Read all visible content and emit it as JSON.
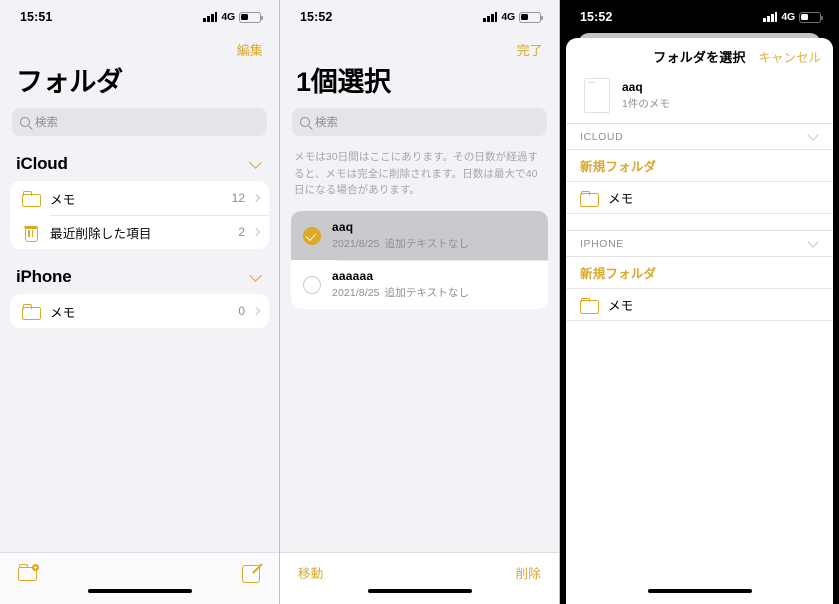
{
  "accent": "#dba828",
  "panels": [
    {
      "id": "folders",
      "status": {
        "time": "15:51",
        "network": "4G"
      },
      "nav_action": "編集",
      "title": "フォルダ",
      "search_placeholder": "検索",
      "sections": [
        {
          "header": "iCloud",
          "rows": [
            {
              "icon": "folder-icon",
              "label": "メモ",
              "count": "12"
            },
            {
              "icon": "trash-icon",
              "label": "最近削除した項目",
              "count": "2"
            }
          ]
        },
        {
          "header": "iPhone",
          "rows": [
            {
              "icon": "folder-icon",
              "label": "メモ",
              "count": "0"
            }
          ]
        }
      ],
      "toolbar": {
        "left_icon": "new-folder-icon",
        "right_icon": "compose-note-icon"
      }
    },
    {
      "id": "selection",
      "status": {
        "time": "15:52",
        "network": "4G"
      },
      "nav_action": "完了",
      "title": "1個選択",
      "search_placeholder": "検索",
      "description": "メモは30日間はここにあります。その日数が経過すると、メモは完全に削除されます。日数は最大で40日になる場合があります。",
      "notes": [
        {
          "title": "aaq",
          "date": "2021/8/25",
          "preview": "追加テキストなし",
          "selected": true
        },
        {
          "title": "aaaaaa",
          "date": "2021/8/25",
          "preview": "追加テキストなし",
          "selected": false
        }
      ],
      "toolbar": {
        "left_label": "移動",
        "right_label": "削除"
      }
    },
    {
      "id": "folder-picker",
      "status": {
        "time": "15:52",
        "network": "4G"
      },
      "sheet_title": "フォルダを選択",
      "cancel_label": "キャンセル",
      "note": {
        "title": "aaq",
        "subtitle": "1件のメモ"
      },
      "groups": [
        {
          "header": "ICLOUD",
          "rows": [
            {
              "type": "new",
              "label": "新規フォルダ"
            },
            {
              "type": "folder",
              "label": "メモ"
            }
          ]
        },
        {
          "header": "IPHONE",
          "rows": [
            {
              "type": "new",
              "label": "新規フォルダ"
            },
            {
              "type": "folder",
              "label": "メモ"
            }
          ]
        }
      ]
    }
  ]
}
